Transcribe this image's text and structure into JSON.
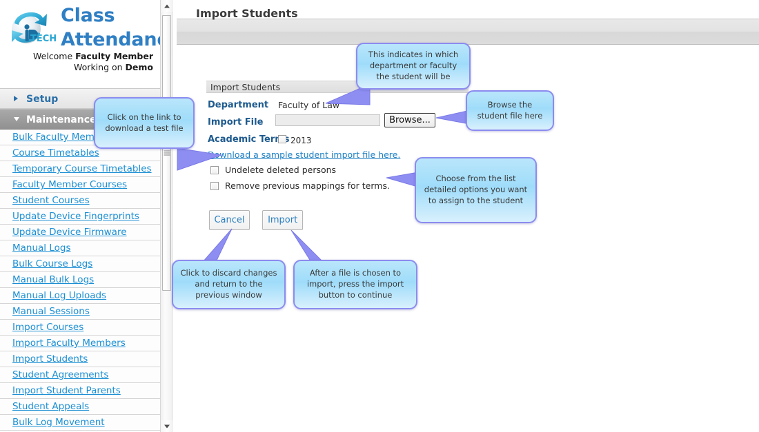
{
  "brand": {
    "logo_text": "TECH",
    "title_line1": "Class",
    "title_line2": "Attendance",
    "welcome_prefix": "Welcome ",
    "welcome_role": "Faculty Member",
    "working_prefix": "Working on ",
    "working_value": "Demo"
  },
  "sidebar": {
    "groups": [
      {
        "label": "Setup",
        "state": "collapsed",
        "icon": "chevron-right-icon"
      },
      {
        "label": "Maintenance",
        "state": "expanded",
        "icon": "chevron-down-icon"
      }
    ],
    "items": [
      "Bulk Faculty Members",
      "Course Timetables",
      "Temporary Course Timetables",
      "Faculty Member Courses",
      "Student Courses",
      "Update Device Fingerprints",
      "Update Device Firmware",
      "Manual Logs",
      "Bulk Course Logs",
      "Manual Bulk Logs",
      "Manual Log Uploads",
      "Manual Sessions",
      "Import Courses",
      "Import Faculty Members",
      "Import Students",
      "Student Agreements",
      "Import Student Parents",
      "Student Appeals",
      "Bulk Log Movement"
    ]
  },
  "header": {
    "page_title": "Import Students"
  },
  "form": {
    "panel_title": "Import Students",
    "department_label": "Department",
    "department_value": "Faculty of Law",
    "import_file_label": "Import File",
    "import_file_value": "",
    "import_file_placeholder": "",
    "browse_label": "Browse...",
    "academic_terms_label": "Academic Terms",
    "academic_term_value": "2013",
    "academic_term_checked": false,
    "sample_link": "Download a sample student import file here.",
    "options": [
      {
        "label": "Undelete deleted persons",
        "checked": false
      },
      {
        "label": "Remove previous mappings for terms.",
        "checked": false
      }
    ],
    "cancel_label": "Cancel",
    "import_label": "Import"
  },
  "callouts": [
    {
      "id": "download-link",
      "text": "Click on the link to download a test file"
    },
    {
      "id": "department",
      "text": "This indicates in which department or faculty the student will be"
    },
    {
      "id": "browse",
      "text": "Browse the student file here"
    },
    {
      "id": "options",
      "text": "Choose from the list detailed options you want to assign to the student"
    },
    {
      "id": "cancel",
      "text": "Click to discard changes and return to the previous window"
    },
    {
      "id": "import",
      "text": "After a file is chosen to import, press the import button to continue"
    }
  ],
  "colors": {
    "brand_blue": "#2f7fc4",
    "link_blue": "#1b8fd4",
    "callout_fill": "#a9e1fa",
    "callout_border": "#8b8bf0",
    "label_blue": "#1e5a8e"
  }
}
